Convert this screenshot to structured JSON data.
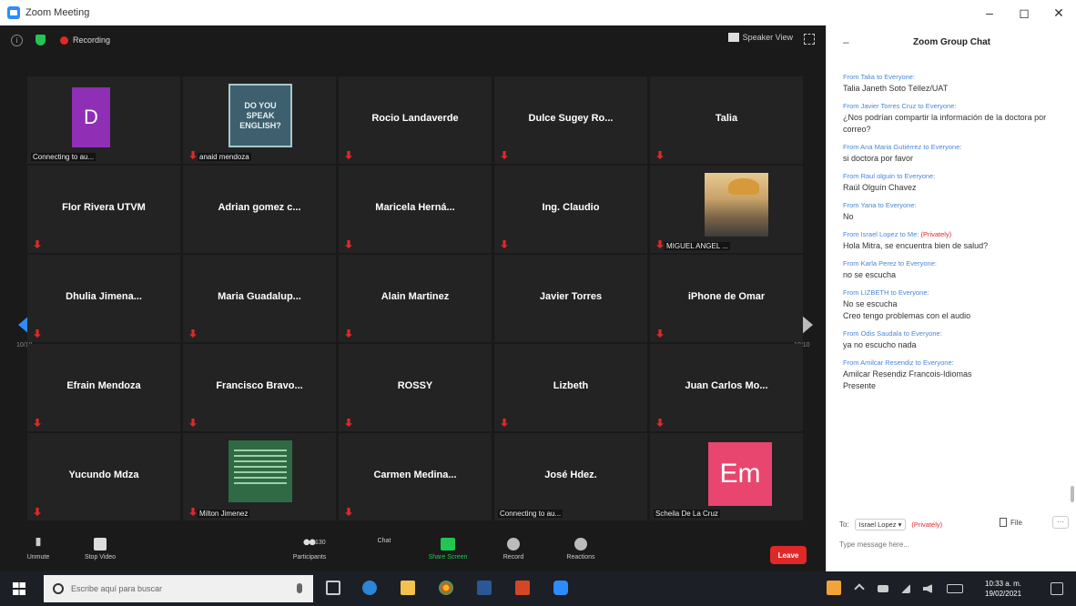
{
  "window": {
    "title": "Zoom Meeting",
    "controls": [
      "–",
      "◻",
      "✕"
    ]
  },
  "meeting": {
    "recording_label": "Recording",
    "view_label": "Speaker View",
    "page_left": "10/10",
    "page_right": "10/10",
    "tiles": [
      {
        "name": "",
        "caption": "Connecting to au...",
        "kind": "avatar-d",
        "avatar": "D",
        "muted": false
      },
      {
        "name": "",
        "caption": "anaid mendoza",
        "kind": "book",
        "muted": true
      },
      {
        "name": "Rocio Landaverde",
        "caption": "",
        "kind": "name",
        "muted": true
      },
      {
        "name": "Dulce Sugey Ro...",
        "caption": "",
        "kind": "name",
        "muted": true
      },
      {
        "name": "Talia",
        "caption": "",
        "kind": "name",
        "muted": true
      },
      {
        "name": "Flor Rivera UTVM",
        "caption": "",
        "kind": "name",
        "muted": true
      },
      {
        "name": "Adrian gomez c...",
        "caption": "",
        "kind": "name",
        "muted": false
      },
      {
        "name": "Maricela Herná...",
        "caption": "",
        "kind": "name",
        "muted": true
      },
      {
        "name": "Ing. Claudio",
        "caption": "",
        "kind": "name",
        "muted": true
      },
      {
        "name": "",
        "caption": "MIGUEL ANGEL ...",
        "kind": "photo",
        "muted": true
      },
      {
        "name": "Dhulia Jimena...",
        "caption": "",
        "kind": "name",
        "muted": true
      },
      {
        "name": "Maria Guadalup...",
        "caption": "",
        "kind": "name",
        "muted": true
      },
      {
        "name": "Alain Martinez",
        "caption": "",
        "kind": "name",
        "muted": true
      },
      {
        "name": "Javier Torres",
        "caption": "",
        "kind": "name",
        "muted": false
      },
      {
        "name": "iPhone de Omar",
        "caption": "",
        "kind": "name",
        "muted": true
      },
      {
        "name": "Efrain Mendoza",
        "caption": "",
        "kind": "name",
        "muted": true
      },
      {
        "name": "Francisco Bravo...",
        "caption": "",
        "kind": "name",
        "muted": true
      },
      {
        "name": "ROSSY",
        "caption": "",
        "kind": "name",
        "muted": true
      },
      {
        "name": "Lizbeth",
        "caption": "",
        "kind": "name",
        "muted": true
      },
      {
        "name": "Juan Carlos Mo...",
        "caption": "",
        "kind": "name",
        "muted": true
      },
      {
        "name": "Yucundo Mdza",
        "caption": "",
        "kind": "name",
        "muted": true
      },
      {
        "name": "",
        "caption": "Milton Jimenez",
        "kind": "doc",
        "muted": true
      },
      {
        "name": "Carmen Medina...",
        "caption": "",
        "kind": "name",
        "muted": true
      },
      {
        "name": "José Hdez.",
        "caption": "Connecting to au...",
        "kind": "name-connecting",
        "muted": false
      },
      {
        "name": "",
        "caption": "Scheila De La Cruz",
        "kind": "avatar-em",
        "avatar": "Em",
        "muted": false
      }
    ],
    "book_text": [
      "DO YOU",
      "SPEAK",
      "ENGLISH?"
    ]
  },
  "controls": {
    "unmute": "Unmute",
    "stop_video": "Stop Video",
    "participants": "Participants",
    "participants_count": "130",
    "chat": "Chat",
    "share_screen": "Share Screen",
    "record": "Record",
    "reactions": "Reactions",
    "leave": "Leave"
  },
  "chat": {
    "title": "Zoom Group Chat",
    "messages": [
      {
        "from": "From Talia to Everyone:",
        "private": "",
        "text": "Talia Janeth Soto Téllez/UAT"
      },
      {
        "from": "From Javier Torres Cruz to Everyone:",
        "private": "",
        "text": "¿Nos podrían compartir la información de la doctora por correo?"
      },
      {
        "from": "From Ana Maria Gutiérrez to Everyone:",
        "private": "",
        "text": "si doctora por favor"
      },
      {
        "from": "From Raul olguin to Everyone:",
        "private": "",
        "text": "Raúl Olguín Chavez"
      },
      {
        "from": "From Yana to Everyone:",
        "private": "",
        "text": "No"
      },
      {
        "from": "From Israel Lopez to Me:",
        "private": "(Privately)",
        "text": "Hola Mitra, se encuentra bien de salud?"
      },
      {
        "from": "From Karla Perez to Everyone:",
        "private": "",
        "text": "no se escucha"
      },
      {
        "from": "From LIZBETH to Everyone:",
        "private": "",
        "text": "No se escucha\nCreo tengo problemas con el audio"
      },
      {
        "from": "From Odis Saudala to Everyone:",
        "private": "",
        "text": "ya no escucho nada"
      },
      {
        "from": "From Amilcar Resendiz to Everyone:",
        "private": "",
        "text": "Amilcar Resendiz Francois-Idiomas\nPresente"
      }
    ],
    "to_label": "To:",
    "to_value": "Israel Lopez ▾",
    "to_private": "(Privately)",
    "file_label": "File",
    "more_label": "···",
    "input_placeholder": "Type message here..."
  },
  "taskbar": {
    "search_placeholder": "Escribe aquí para buscar",
    "time": "10:33 a. m.",
    "date": "19/02/2021"
  },
  "colors": {
    "meeting_bg": "#1a1a1a",
    "tile_bg": "#232323",
    "accent": "#2d8cff",
    "danger": "#e02828",
    "green": "#23c552"
  }
}
